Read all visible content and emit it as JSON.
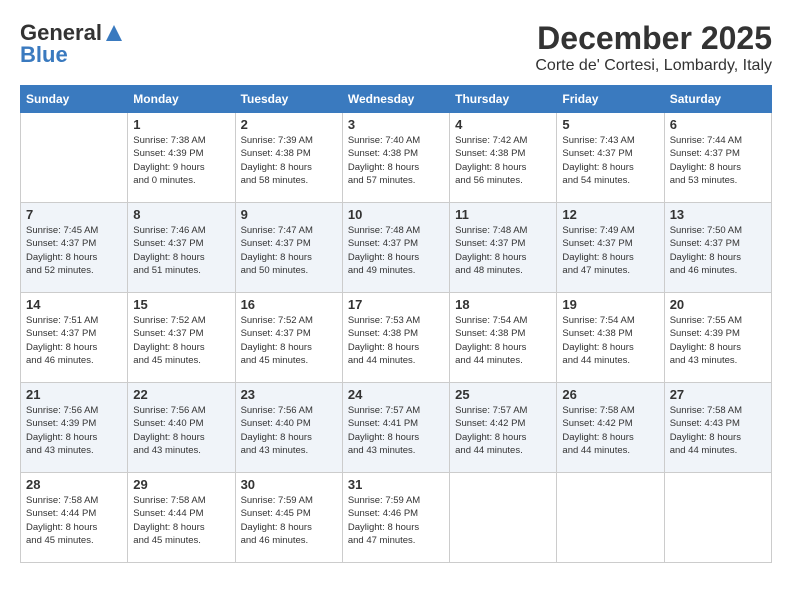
{
  "header": {
    "logo_general": "General",
    "logo_blue": "Blue",
    "month": "December 2025",
    "location": "Corte de' Cortesi, Lombardy, Italy"
  },
  "calendar": {
    "days_of_week": [
      "Sunday",
      "Monday",
      "Tuesday",
      "Wednesday",
      "Thursday",
      "Friday",
      "Saturday"
    ],
    "weeks": [
      [
        {
          "day": "",
          "detail": ""
        },
        {
          "day": "1",
          "detail": "Sunrise: 7:38 AM\nSunset: 4:39 PM\nDaylight: 9 hours\nand 0 minutes."
        },
        {
          "day": "2",
          "detail": "Sunrise: 7:39 AM\nSunset: 4:38 PM\nDaylight: 8 hours\nand 58 minutes."
        },
        {
          "day": "3",
          "detail": "Sunrise: 7:40 AM\nSunset: 4:38 PM\nDaylight: 8 hours\nand 57 minutes."
        },
        {
          "day": "4",
          "detail": "Sunrise: 7:42 AM\nSunset: 4:38 PM\nDaylight: 8 hours\nand 56 minutes."
        },
        {
          "day": "5",
          "detail": "Sunrise: 7:43 AM\nSunset: 4:37 PM\nDaylight: 8 hours\nand 54 minutes."
        },
        {
          "day": "6",
          "detail": "Sunrise: 7:44 AM\nSunset: 4:37 PM\nDaylight: 8 hours\nand 53 minutes."
        }
      ],
      [
        {
          "day": "7",
          "detail": "Sunrise: 7:45 AM\nSunset: 4:37 PM\nDaylight: 8 hours\nand 52 minutes."
        },
        {
          "day": "8",
          "detail": "Sunrise: 7:46 AM\nSunset: 4:37 PM\nDaylight: 8 hours\nand 51 minutes."
        },
        {
          "day": "9",
          "detail": "Sunrise: 7:47 AM\nSunset: 4:37 PM\nDaylight: 8 hours\nand 50 minutes."
        },
        {
          "day": "10",
          "detail": "Sunrise: 7:48 AM\nSunset: 4:37 PM\nDaylight: 8 hours\nand 49 minutes."
        },
        {
          "day": "11",
          "detail": "Sunrise: 7:48 AM\nSunset: 4:37 PM\nDaylight: 8 hours\nand 48 minutes."
        },
        {
          "day": "12",
          "detail": "Sunrise: 7:49 AM\nSunset: 4:37 PM\nDaylight: 8 hours\nand 47 minutes."
        },
        {
          "day": "13",
          "detail": "Sunrise: 7:50 AM\nSunset: 4:37 PM\nDaylight: 8 hours\nand 46 minutes."
        }
      ],
      [
        {
          "day": "14",
          "detail": "Sunrise: 7:51 AM\nSunset: 4:37 PM\nDaylight: 8 hours\nand 46 minutes."
        },
        {
          "day": "15",
          "detail": "Sunrise: 7:52 AM\nSunset: 4:37 PM\nDaylight: 8 hours\nand 45 minutes."
        },
        {
          "day": "16",
          "detail": "Sunrise: 7:52 AM\nSunset: 4:37 PM\nDaylight: 8 hours\nand 45 minutes."
        },
        {
          "day": "17",
          "detail": "Sunrise: 7:53 AM\nSunset: 4:38 PM\nDaylight: 8 hours\nand 44 minutes."
        },
        {
          "day": "18",
          "detail": "Sunrise: 7:54 AM\nSunset: 4:38 PM\nDaylight: 8 hours\nand 44 minutes."
        },
        {
          "day": "19",
          "detail": "Sunrise: 7:54 AM\nSunset: 4:38 PM\nDaylight: 8 hours\nand 44 minutes."
        },
        {
          "day": "20",
          "detail": "Sunrise: 7:55 AM\nSunset: 4:39 PM\nDaylight: 8 hours\nand 43 minutes."
        }
      ],
      [
        {
          "day": "21",
          "detail": "Sunrise: 7:56 AM\nSunset: 4:39 PM\nDaylight: 8 hours\nand 43 minutes."
        },
        {
          "day": "22",
          "detail": "Sunrise: 7:56 AM\nSunset: 4:40 PM\nDaylight: 8 hours\nand 43 minutes."
        },
        {
          "day": "23",
          "detail": "Sunrise: 7:56 AM\nSunset: 4:40 PM\nDaylight: 8 hours\nand 43 minutes."
        },
        {
          "day": "24",
          "detail": "Sunrise: 7:57 AM\nSunset: 4:41 PM\nDaylight: 8 hours\nand 43 minutes."
        },
        {
          "day": "25",
          "detail": "Sunrise: 7:57 AM\nSunset: 4:42 PM\nDaylight: 8 hours\nand 44 minutes."
        },
        {
          "day": "26",
          "detail": "Sunrise: 7:58 AM\nSunset: 4:42 PM\nDaylight: 8 hours\nand 44 minutes."
        },
        {
          "day": "27",
          "detail": "Sunrise: 7:58 AM\nSunset: 4:43 PM\nDaylight: 8 hours\nand 44 minutes."
        }
      ],
      [
        {
          "day": "28",
          "detail": "Sunrise: 7:58 AM\nSunset: 4:44 PM\nDaylight: 8 hours\nand 45 minutes."
        },
        {
          "day": "29",
          "detail": "Sunrise: 7:58 AM\nSunset: 4:44 PM\nDaylight: 8 hours\nand 45 minutes."
        },
        {
          "day": "30",
          "detail": "Sunrise: 7:59 AM\nSunset: 4:45 PM\nDaylight: 8 hours\nand 46 minutes."
        },
        {
          "day": "31",
          "detail": "Sunrise: 7:59 AM\nSunset: 4:46 PM\nDaylight: 8 hours\nand 47 minutes."
        },
        {
          "day": "",
          "detail": ""
        },
        {
          "day": "",
          "detail": ""
        },
        {
          "day": "",
          "detail": ""
        }
      ]
    ]
  }
}
